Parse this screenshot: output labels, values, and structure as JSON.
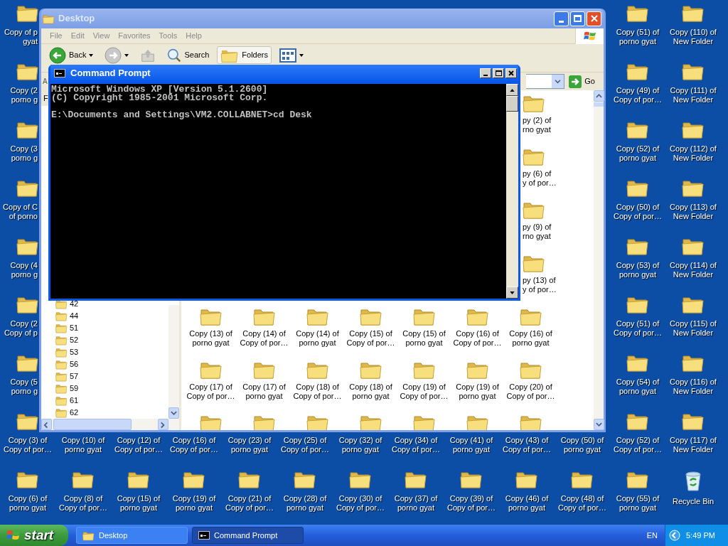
{
  "desktop": {
    "top_rows": [
      {
        "left": "Copy of p\ngyat",
        "right": [
          "Copy (51) of\nporno gyat",
          "Copy (110) of\nNew Folder"
        ]
      },
      {
        "left": "Copy (2\nporno g",
        "right": [
          "Copy (49) of\nCopy of por…",
          "Copy (111) of\nNew Folder"
        ]
      },
      {
        "left": "Copy (3\nporno g",
        "right": [
          "Copy (52) of\nporno gyat",
          "Copy (112) of\nNew Folder"
        ]
      },
      {
        "left": "Copy of C\nof porno",
        "right": [
          "Copy (50) of\nCopy of por…",
          "Copy (113) of\nNew Folder"
        ]
      },
      {
        "left": "Copy (4\nporno g",
        "right": [
          "Copy (53) of\nporno gyat",
          "Copy (114) of\nNew Folder"
        ]
      },
      {
        "left": "Copy (2\nCopy of p",
        "right": [
          "Copy (51) of\nCopy of por…",
          "Copy (115) of\nNew Folder"
        ]
      },
      {
        "left": "Copy (5\nporno g",
        "right": [
          "Copy (54) of\nporno gyat",
          "Copy (116) of\nNew Folder"
        ]
      }
    ],
    "bottom_rows": [
      [
        {
          "label": "Copy (3) of\nCopy of por…",
          "kind": "folder"
        },
        {
          "label": "Copy (10) of\nporno gyat",
          "kind": "label_only"
        },
        {
          "label": "Copy (12) of\nCopy of por…",
          "kind": "label_only"
        },
        {
          "label": "Copy (16) of\nCopy of por…",
          "kind": "label_only"
        },
        {
          "label": "Copy (23) of\nporno gyat",
          "kind": "label_only"
        },
        {
          "label": "Copy (25) of\nCopy of por…",
          "kind": "label_only"
        },
        {
          "label": "Copy (32) of\nporno gyat",
          "kind": "label_only"
        },
        {
          "label": "Copy (34) of\nCopy of por…",
          "kind": "label_only"
        },
        {
          "label": "Copy (41) of\nporno gyat",
          "kind": "label_only"
        },
        {
          "label": "Copy (43) of\nCopy of por…",
          "kind": "label_only"
        },
        {
          "label": "Copy (50) of\nporno gyat",
          "kind": "label_only"
        },
        {
          "label": "Copy (52) of\nCopy of por…",
          "kind": "folder"
        },
        {
          "label": "Copy (117) of\nNew Folder",
          "kind": "folder"
        }
      ],
      [
        {
          "label": "Copy (6) of\nporno gyat",
          "kind": "folder"
        },
        {
          "label": "Copy (8) of\nCopy of por…",
          "kind": "folder"
        },
        {
          "label": "Copy (15) of\nporno gyat",
          "kind": "folder"
        },
        {
          "label": "Copy (19) of\nporno gyat",
          "kind": "folder"
        },
        {
          "label": "Copy (21) of\nCopy of por…",
          "kind": "folder"
        },
        {
          "label": "Copy (28) of\nporno gyat",
          "kind": "folder"
        },
        {
          "label": "Copy (30) of\nCopy of por…",
          "kind": "folder"
        },
        {
          "label": "Copy (37) of\nporno gyat",
          "kind": "folder"
        },
        {
          "label": "Copy (39) of\nCopy of por…",
          "kind": "folder"
        },
        {
          "label": "Copy (46) of\nporno gyat",
          "kind": "folder"
        },
        {
          "label": "Copy (48) of\nCopy of por…",
          "kind": "folder"
        },
        {
          "label": "Copy (55) of\nporno gyat",
          "kind": "folder"
        },
        {
          "label": "Recycle Bin",
          "kind": "recycle_bin"
        }
      ]
    ]
  },
  "explorer": {
    "title": "Desktop",
    "menu": [
      "File",
      "Edit",
      "View",
      "Favorites",
      "Tools",
      "Help"
    ],
    "toolbar": [
      {
        "kind": "back",
        "label": "Back",
        "selected": false
      },
      {
        "kind": "forward",
        "selected": false
      },
      {
        "kind": "up",
        "selected": false
      },
      {
        "kind": "search",
        "label": "Search",
        "selected": false
      },
      {
        "kind": "folders",
        "label": "Folders",
        "selected": true
      },
      {
        "kind": "views",
        "selected": false
      }
    ],
    "address_label": "A",
    "go": "Go",
    "pane_title": "F",
    "tree": [
      "42",
      "44",
      "51",
      "52",
      "53",
      "56",
      "57",
      "59",
      "61",
      "62"
    ],
    "files_partial": [
      "py (2) of\nrno gyat",
      "py (6) of\ny of por…",
      "py (9) of\nrno gyat",
      "py (13) of\ny of por…"
    ],
    "files": [
      "Copy (13) of\nporno gyat",
      "Copy (14) of\nCopy of por…",
      "Copy (14) of\nporno gyat",
      "Copy (15) of\nCopy of por…",
      "Copy (15) of\nporno gyat",
      "Copy (16) of\nCopy of por…",
      "Copy (16) of\nporno gyat",
      "Copy (17) of\nCopy of por…",
      "Copy (17) of\nporno gyat",
      "Copy (18) of\nCopy of por…",
      "Copy (18) of\nporno gyat",
      "Copy (19) of\nCopy of por…",
      "Copy (19) of\nporno gyat",
      "Copy (20) of\nCopy of por…"
    ]
  },
  "console": {
    "title": "Command Prompt",
    "banner": [
      "Microsoft Windows XP [Version 5.1.2600]",
      "(C) Copyright 1985-2001 Microsoft Corp."
    ],
    "prompt": "E:\\Documents and Settings\\VM2.COLLABNET>cd Desk"
  },
  "taskbar": {
    "start": "start",
    "tasks": [
      {
        "label": "Desktop",
        "kind": "explorer",
        "selected": false
      },
      {
        "label": "Command Prompt",
        "kind": "console",
        "selected": true
      }
    ],
    "language": "EN",
    "clock": "5:49 PM"
  }
}
